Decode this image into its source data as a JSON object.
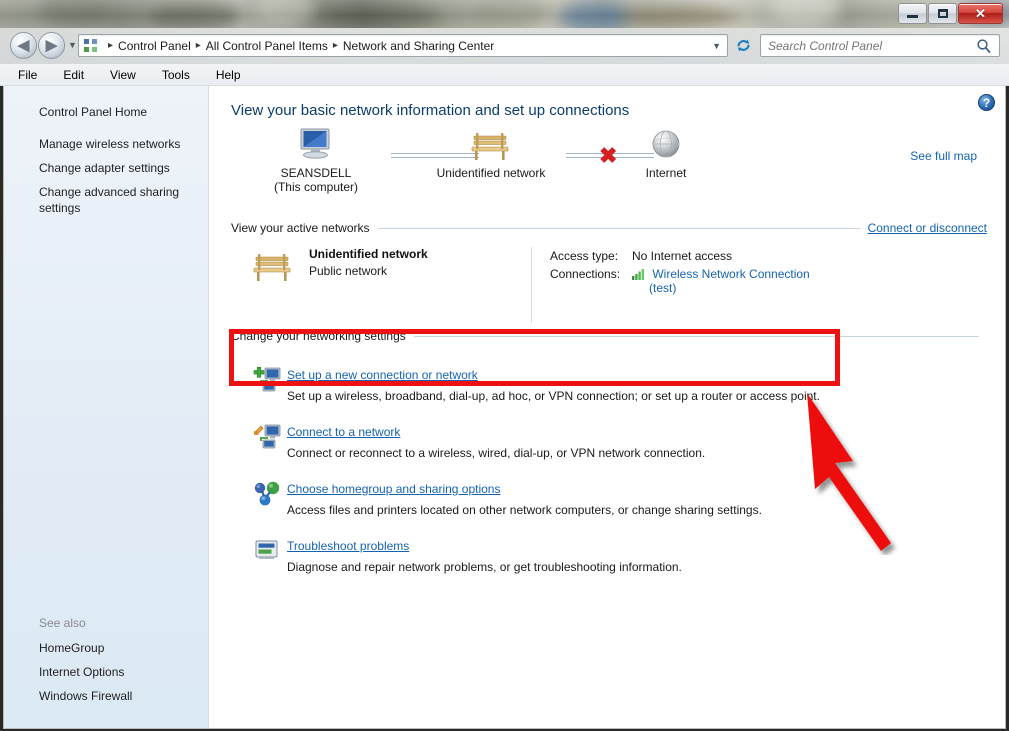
{
  "window": {
    "controls": {
      "minimize": "Minimize",
      "maximize": "Maximize",
      "close": "Close"
    }
  },
  "addressbar": {
    "crumbs": [
      "Control Panel",
      "All Control Panel Items",
      "Network and Sharing Center"
    ],
    "separator": "▸",
    "dropdown_glyph": "▼",
    "refresh_glyph": "↻",
    "back_glyph": "◀",
    "forward_glyph": "▶"
  },
  "search": {
    "placeholder": "Search Control Panel",
    "icon": "search-icon"
  },
  "menubar": {
    "items": [
      "File",
      "Edit",
      "View",
      "Tools",
      "Help"
    ]
  },
  "sidebar": {
    "home": "Control Panel Home",
    "items": [
      "Manage wireless networks",
      "Change adapter settings",
      "Change advanced sharing settings"
    ],
    "see_also_label": "See also",
    "see_also": [
      "HomeGroup",
      "Internet Options",
      "Windows Firewall"
    ]
  },
  "content": {
    "title": "View your basic network information and set up connections",
    "help_glyph": "?",
    "map": {
      "see_full_map": "See full map",
      "nodes": [
        {
          "label": "SEANSDELL",
          "label2": "(This computer)",
          "icon": "computer-icon"
        },
        {
          "label": "Unidentified network",
          "label2": "",
          "icon": "bench-icon"
        },
        {
          "label": "Internet",
          "label2": "",
          "icon": "globe-icon"
        }
      ],
      "broken_glyph": "✖"
    },
    "active_section": {
      "heading": "View your active networks",
      "action": "Connect or disconnect",
      "network_name": "Unidentified network",
      "network_type": "Public network",
      "access_type_label": "Access type:",
      "access_type_value": "No Internet access",
      "connections_label": "Connections:",
      "connection_name": "Wireless Network Connection",
      "connection_detail": "(test)"
    },
    "settings_section": {
      "heading": "Change your networking settings",
      "tasks": [
        {
          "link": "Set up a new connection or network",
          "desc": "Set up a wireless, broadband, dial-up, ad hoc, or VPN connection; or set up a router or access point.",
          "icon": "new-connection-icon",
          "highlighted": true
        },
        {
          "link": "Connect to a network",
          "desc": "Connect or reconnect to a wireless, wired, dial-up, or VPN network connection.",
          "icon": "connect-network-icon",
          "highlighted": false
        },
        {
          "link": "Choose homegroup and sharing options",
          "desc": "Access files and printers located on other network computers, or change sharing settings.",
          "icon": "homegroup-icon",
          "highlighted": false
        },
        {
          "link": "Troubleshoot problems",
          "desc": "Diagnose and repair network problems, or get troubleshooting information.",
          "icon": "troubleshoot-icon",
          "highlighted": false
        }
      ]
    }
  },
  "annotations": {
    "highlight_box_color": "#ee1111",
    "arrow_color": "#ee1111",
    "link_color": "#1563b0",
    "title_color": "#0b3d6b"
  }
}
